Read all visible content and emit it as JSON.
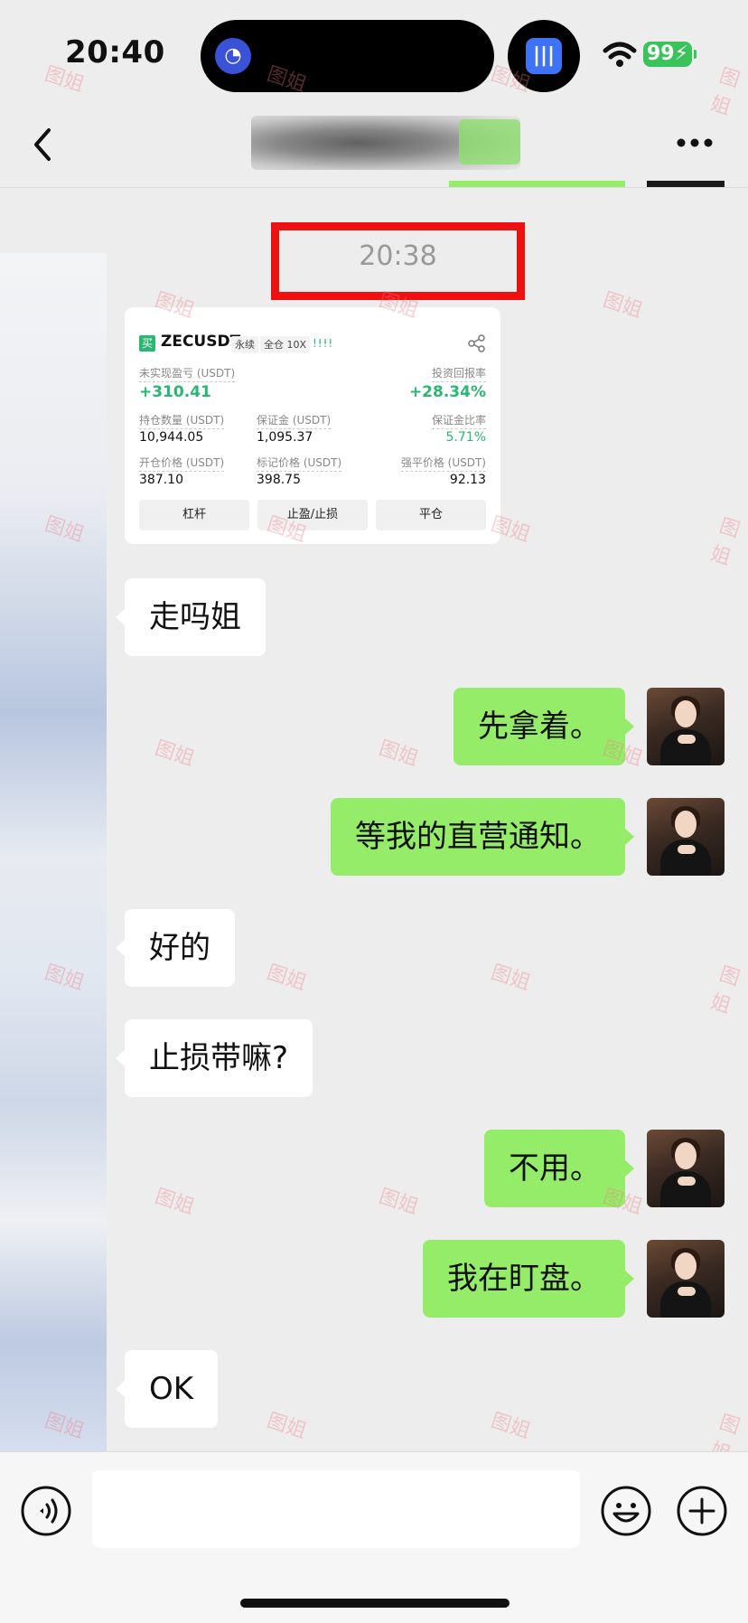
{
  "status_bar": {
    "time": "20:40",
    "battery": "99"
  },
  "timestamp": "20:38",
  "trade_card": {
    "side": "买",
    "symbol": "ZECUSDT",
    "tags": [
      "永续",
      "全仓 10X"
    ],
    "bars": "!!!!",
    "unrealized_pnl_label": "未实现盈亏 (USDT)",
    "unrealized_pnl_value": "+310.41",
    "roi_label": "投资回报率",
    "roi_value": "+28.34%",
    "position_label": "持仓数量 (USDT)",
    "position_value": "10,944.05",
    "margin_label": "保证金 (USDT)",
    "margin_value": "1,095.37",
    "margin_ratio_label": "保证金比率",
    "margin_ratio_value": "5.71%",
    "entry_label": "开仓价格 (USDT)",
    "entry_value": "387.10",
    "mark_label": "标记价格 (USDT)",
    "mark_value": "398.75",
    "liq_label": "强平价格 (USDT)",
    "liq_value": "92.13",
    "buttons": [
      "杠杆",
      "止盈/止损",
      "平仓"
    ]
  },
  "messages": [
    {
      "dir": "in",
      "text": "走吗姐"
    },
    {
      "dir": "out",
      "text": "先拿着。"
    },
    {
      "dir": "out",
      "text": "等我的直营通知。"
    },
    {
      "dir": "in",
      "text": "好的"
    },
    {
      "dir": "in",
      "text": "止损带嘛?"
    },
    {
      "dir": "out",
      "text": "不用。"
    },
    {
      "dir": "out",
      "text": "我在盯盘。"
    },
    {
      "dir": "in",
      "text": "OK"
    }
  ],
  "watermark": "图姐",
  "input": {
    "value": "",
    "placeholder": ""
  },
  "colors": {
    "outgoing_bubble": "#95ec69",
    "incoming_bubble": "#ffffff",
    "highlight_box": "#ee1111",
    "positive": "#2bb673"
  }
}
